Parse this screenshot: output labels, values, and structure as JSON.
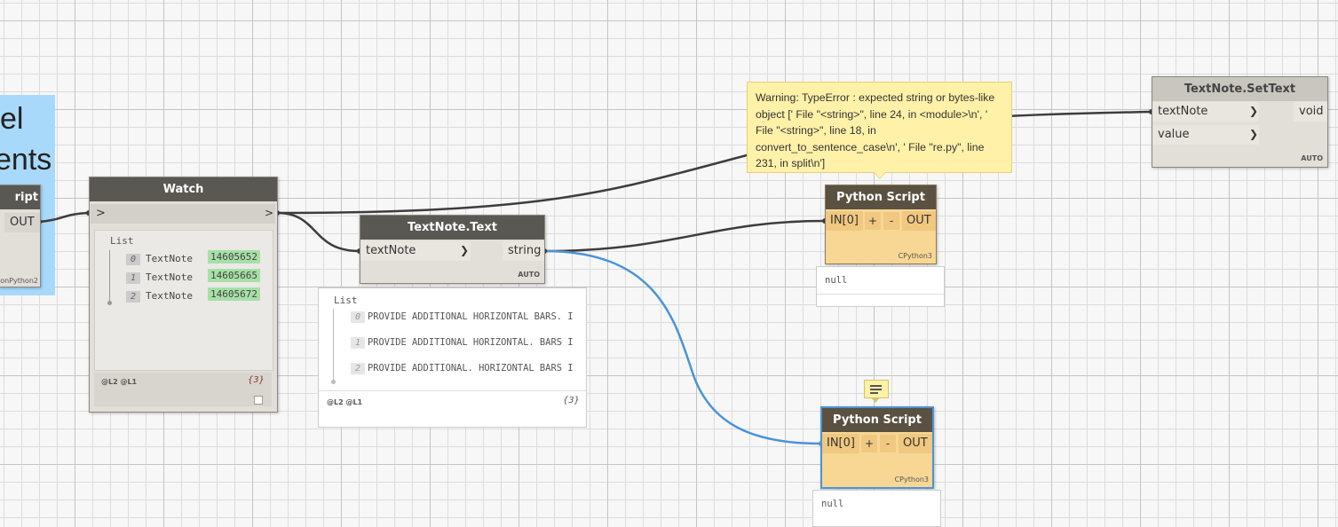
{
  "group": {
    "title_line1": "el",
    "title_line2": "ents"
  },
  "partial_node": {
    "header_fragment": "ript",
    "out_label": "OUT",
    "engine_fragment": "onPython2"
  },
  "watch": {
    "title": "Watch",
    "in_port": ">",
    "out_port": ">",
    "list_title": "List",
    "items": [
      {
        "index": "0",
        "label": "TextNote",
        "value": "14605652"
      },
      {
        "index": "1",
        "label": "TextNote",
        "value": "14605665"
      },
      {
        "index": "2",
        "label": "TextNote",
        "value": "14605672"
      }
    ],
    "levels": "@L2 @L1",
    "count": "{3}"
  },
  "textnote_text": {
    "title": "TextNote.Text",
    "input": "textNote",
    "output": "string",
    "lacing": "AUTO",
    "preview": {
      "list_title": "List",
      "items": [
        {
          "index": "0",
          "text": "PROVIDE ADDITIONAL HORIZONTAL BARS. I"
        },
        {
          "index": "1",
          "text": "PROVIDE ADDITIONAL HORIZONTAL. BARS I"
        },
        {
          "index": "2",
          "text": "PROVIDE ADDITIONAL. HORIZONTAL BARS I"
        }
      ],
      "levels": "@L2 @L1",
      "count": "{3}"
    }
  },
  "warning": {
    "text": "Warning: TypeError : expected string or bytes-like object ['  File \"<string>\", line 24, in <module>\\n', '  File \"<string>\", line 18, in convert_to_sentence_case\\n', '  File \"re.py\", line 231, in split\\n']"
  },
  "python_top": {
    "title": "Python Script",
    "input": "IN[0]",
    "plus": "+",
    "minus": "-",
    "output": "OUT",
    "engine": "CPython3",
    "preview": "null"
  },
  "python_bottom": {
    "title": "Python Script",
    "input": "IN[0]",
    "plus": "+",
    "minus": "-",
    "output": "OUT",
    "engine": "CPython3",
    "preview": "null",
    "note_icon": "note-icon"
  },
  "settext": {
    "title": "TextNote.SetText",
    "inputs": [
      "textNote",
      "value"
    ],
    "output": "void",
    "lacing": "AUTO"
  },
  "colors": {
    "wire": "#3d3d3d",
    "selected_wire": "#4a94d8",
    "group": "#a9d9fa",
    "warning": "#fff1a8",
    "python_body": "#f8d795"
  }
}
